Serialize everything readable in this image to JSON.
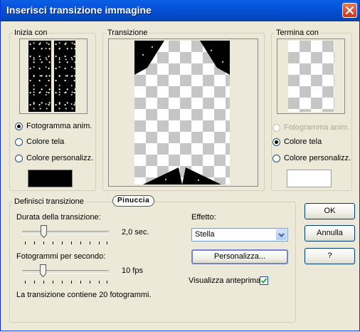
{
  "window": {
    "title": "Inserisci transizione immagine",
    "accent": "#0a5fe6"
  },
  "inizia": {
    "label": "Inizia con",
    "options": [
      "Fotogramma anim.",
      "Colore tela",
      "Colore personalizz."
    ],
    "selected": 0,
    "swatch_color": "#000000"
  },
  "transizione": {
    "label": "Transizione"
  },
  "termina": {
    "label": "Termina con",
    "options": [
      "Fotogramma anim.",
      "Colore tela",
      "Colore personalizz."
    ],
    "selected": 1,
    "swatch_color": "#ffffff"
  },
  "definisci": {
    "label": "Definisci transizione",
    "durata_label": "Durata della transizione:",
    "durata_value": "2,0 sec.",
    "fps_label": "Fotogrammi per secondo:",
    "fps_value": "10 fps",
    "info": "La transizione contiene 20 fotogrammi.",
    "effetto_label": "Effetto:",
    "effetto_value": "Stella",
    "personalizza_label": "Personalizza...",
    "anteprima_label": "Visualizza anteprima",
    "anteprima_checked": true
  },
  "buttons": {
    "ok": "OK",
    "annulla": "Annulla",
    "help": "?"
  },
  "watermark": "Pinuccia"
}
